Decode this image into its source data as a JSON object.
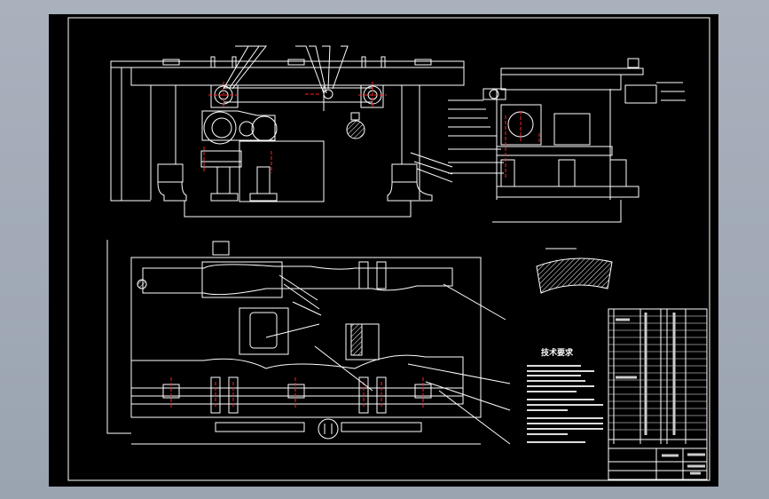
{
  "drawing": {
    "technical_requirements_heading": "技术要求",
    "colors": {
      "background": "#000000",
      "lines": "#ffffff",
      "centerlines": "#ff2020",
      "viewport_frame": "#a5adb8"
    }
  }
}
